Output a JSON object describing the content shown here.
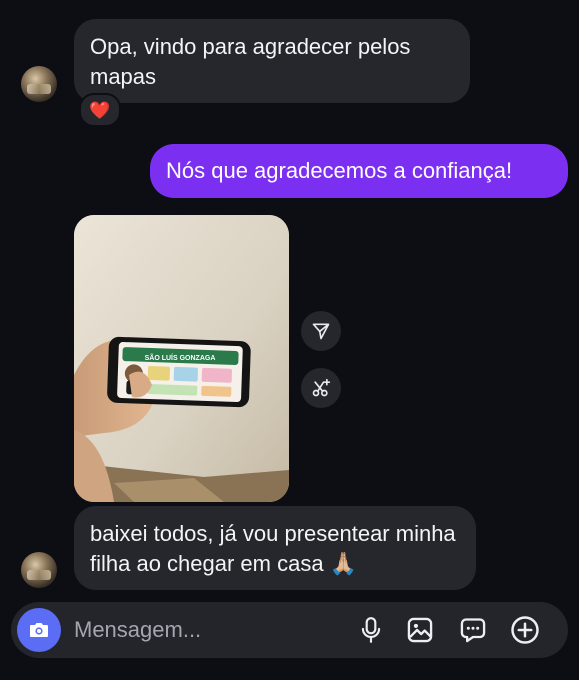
{
  "messages": [
    {
      "from": "them",
      "text": "Opa, vindo para agradecer pelos mapas",
      "reaction": "❤️"
    },
    {
      "from": "me",
      "text": "Nós que agradecemos a confiança!"
    },
    {
      "from": "them",
      "type": "photo"
    },
    {
      "from": "them",
      "text": "baixei todos, já vou presentear minha filha ao chegar em casa 🙏🏼"
    }
  ],
  "photo_content": {
    "title": "SÃO LUÍS GONZAGA"
  },
  "composer": {
    "placeholder": "Mensagem..."
  },
  "icons": {
    "share": "send-icon",
    "remix": "scissors-sparkle-icon",
    "camera": "camera-icon",
    "mic": "microphone-icon",
    "gallery": "image-icon",
    "sticker": "chat-dots-icon",
    "add": "plus-circle-icon"
  },
  "colors": {
    "background": "#0c0e14",
    "incoming_bubble": "#25272d",
    "outgoing_bubble": "#7b2ff0",
    "camera_button": "#5b6cf5"
  }
}
